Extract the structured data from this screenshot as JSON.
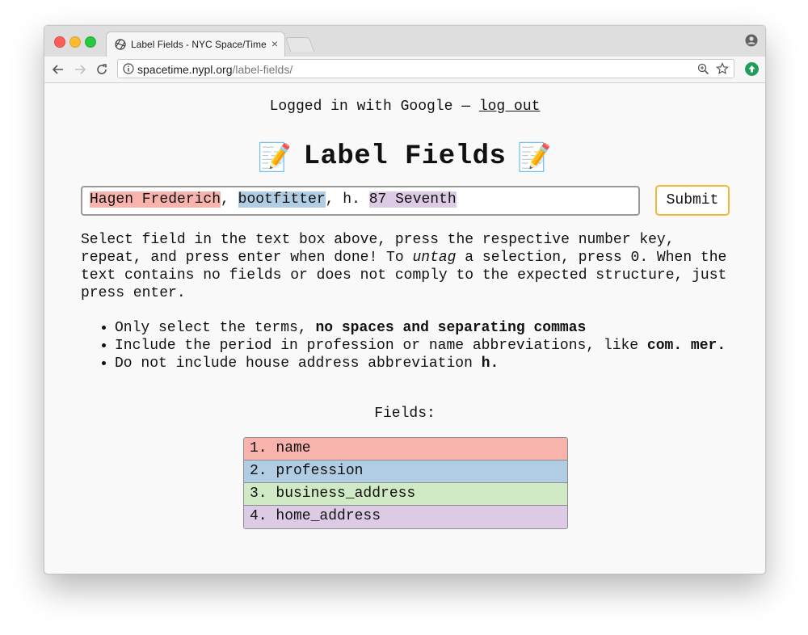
{
  "browser": {
    "tab_title": "Label Fields - NYC Space/Time",
    "tab_close": "×",
    "url_host": "spacetime.nypl.org",
    "url_path": "/label-fields/"
  },
  "page": {
    "login_text": "Logged in with Google — ",
    "logout_link": "log out",
    "title": "Label Fields",
    "title_emoji_left": "📝",
    "title_emoji_right": "📝",
    "input_segments": [
      {
        "text": "Hagen Frederich",
        "field": "name"
      },
      {
        "text": ", ",
        "field": ""
      },
      {
        "text": "bootfitter",
        "field": "profession"
      },
      {
        "text": ", h. ",
        "field": ""
      },
      {
        "text": "87 Seventh",
        "field": "home_address"
      }
    ],
    "submit_label": "Submit",
    "instructions_part1": "Select field in the text box above, press the respective number key, repeat, and press enter when done! To ",
    "instructions_italic": "untag",
    "instructions_part2": " a selection, press 0. When the text contains no fields or does not comply to the expected structure, just press enter.",
    "rules": [
      {
        "text": "Only select the terms, ",
        "bold": "no spaces and separating commas"
      },
      {
        "text": "Include the period in profession or name abbreviations, like ",
        "bold": "com. mer."
      },
      {
        "text": "Do not include house address abbreviation ",
        "bold": "h."
      }
    ],
    "fields_label": "Fields:",
    "fields": [
      {
        "label": "1. name",
        "color": "#f8b3ad"
      },
      {
        "label": "2. profession",
        "color": "#b1cde3"
      },
      {
        "label": "3. business_address",
        "color": "#cfeac4"
      },
      {
        "label": "4. home_address",
        "color": "#ddcbe6"
      }
    ]
  }
}
